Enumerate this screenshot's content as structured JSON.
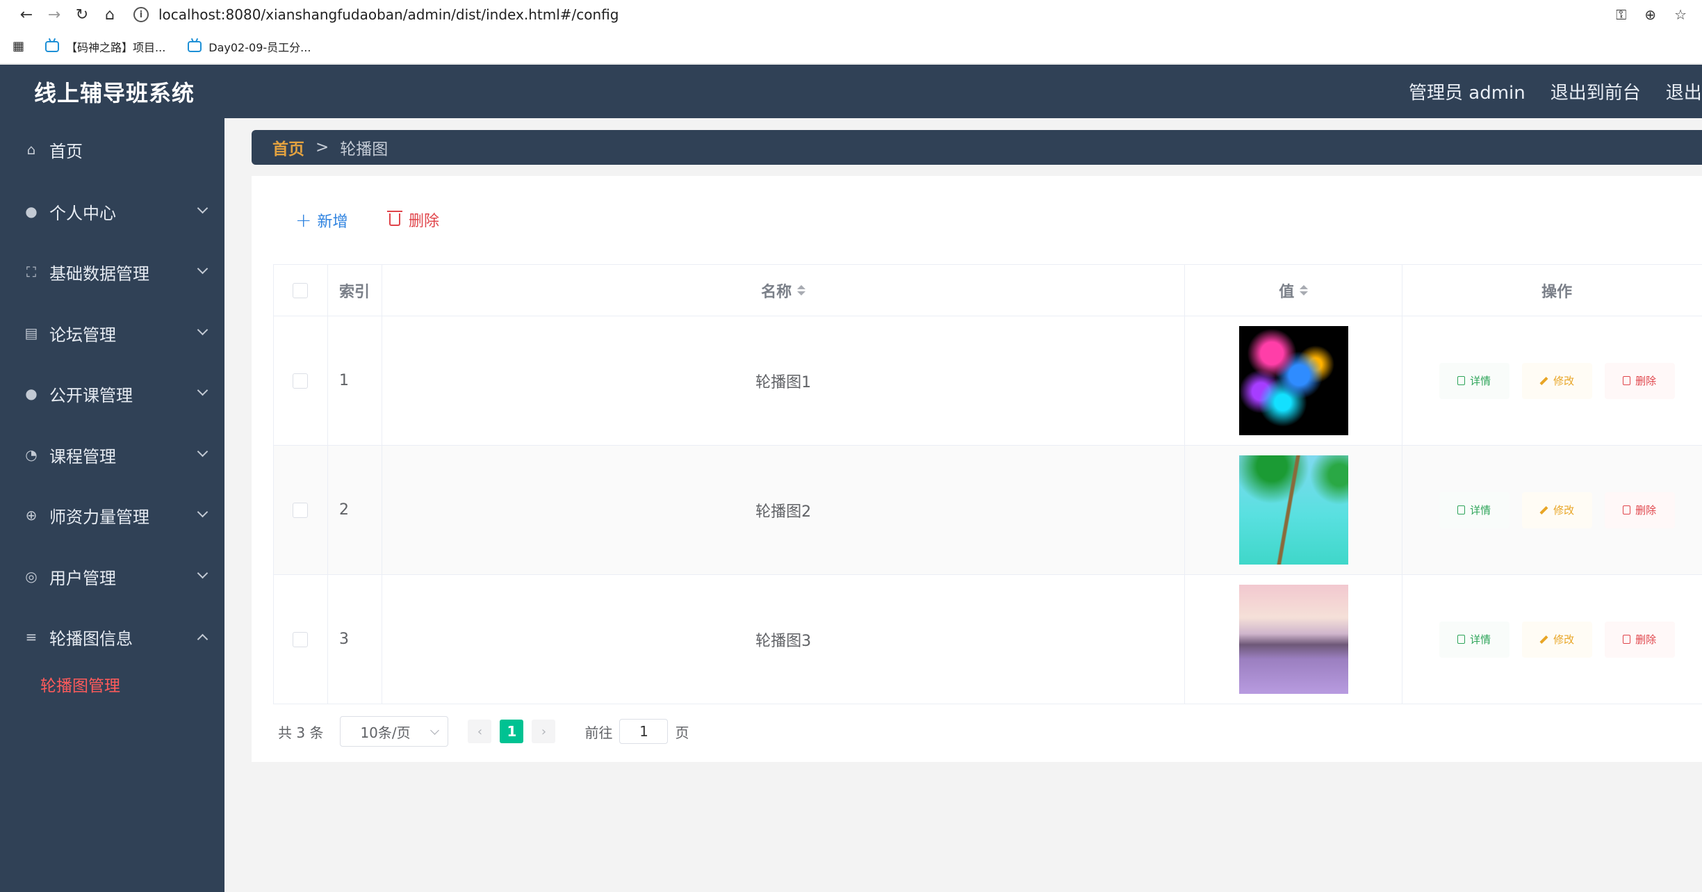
{
  "browser": {
    "url": "localhost:8080/xianshangfudaoban/admin/dist/index.html#/config",
    "bookmarks": [
      "【码神之路】项目...",
      "Day02-09-员工分..."
    ]
  },
  "header": {
    "title": "线上辅导班系统",
    "user": "管理员 admin",
    "to_front": "退出到前台",
    "logout": "退出登录"
  },
  "sidebar": {
    "items": [
      {
        "label": "首页",
        "icon": "home-icon"
      },
      {
        "label": "个人中心",
        "icon": "user-icon"
      },
      {
        "label": "基础数据管理",
        "icon": "frame-icon"
      },
      {
        "label": "论坛管理",
        "icon": "message-icon"
      },
      {
        "label": "公开课管理",
        "icon": "user-icon"
      },
      {
        "label": "课程管理",
        "icon": "compass-icon"
      },
      {
        "label": "师资力量管理",
        "icon": "target-icon"
      },
      {
        "label": "用户管理",
        "icon": "lifebuoy-icon"
      },
      {
        "label": "轮播图信息",
        "icon": "menu-icon"
      }
    ],
    "active_sub": "轮播图管理"
  },
  "breadcrumb": {
    "home": "首页",
    "separator": ">",
    "current": "轮播图"
  },
  "toolbar": {
    "add": "新增",
    "delete": "删除"
  },
  "table": {
    "columns": {
      "index": "索引",
      "name": "名称",
      "value": "值",
      "actions": "操作"
    },
    "rows": [
      {
        "index": "1",
        "name": "轮播图1"
      },
      {
        "index": "2",
        "name": "轮播图2"
      },
      {
        "index": "3",
        "name": "轮播图3"
      }
    ],
    "actions": {
      "detail": "详情",
      "edit": "修改",
      "remove": "删除"
    }
  },
  "pagination": {
    "total": "共 3 条",
    "page_size": "10条/页",
    "current_page": "1",
    "goto_label": "前往",
    "goto_value": "1",
    "page_unit": "页"
  },
  "colors": {
    "sidebar": "#304156",
    "accent": "#00c292",
    "active_menu": "#ff5b5b",
    "breadcrumb_home": "#e3a240"
  }
}
